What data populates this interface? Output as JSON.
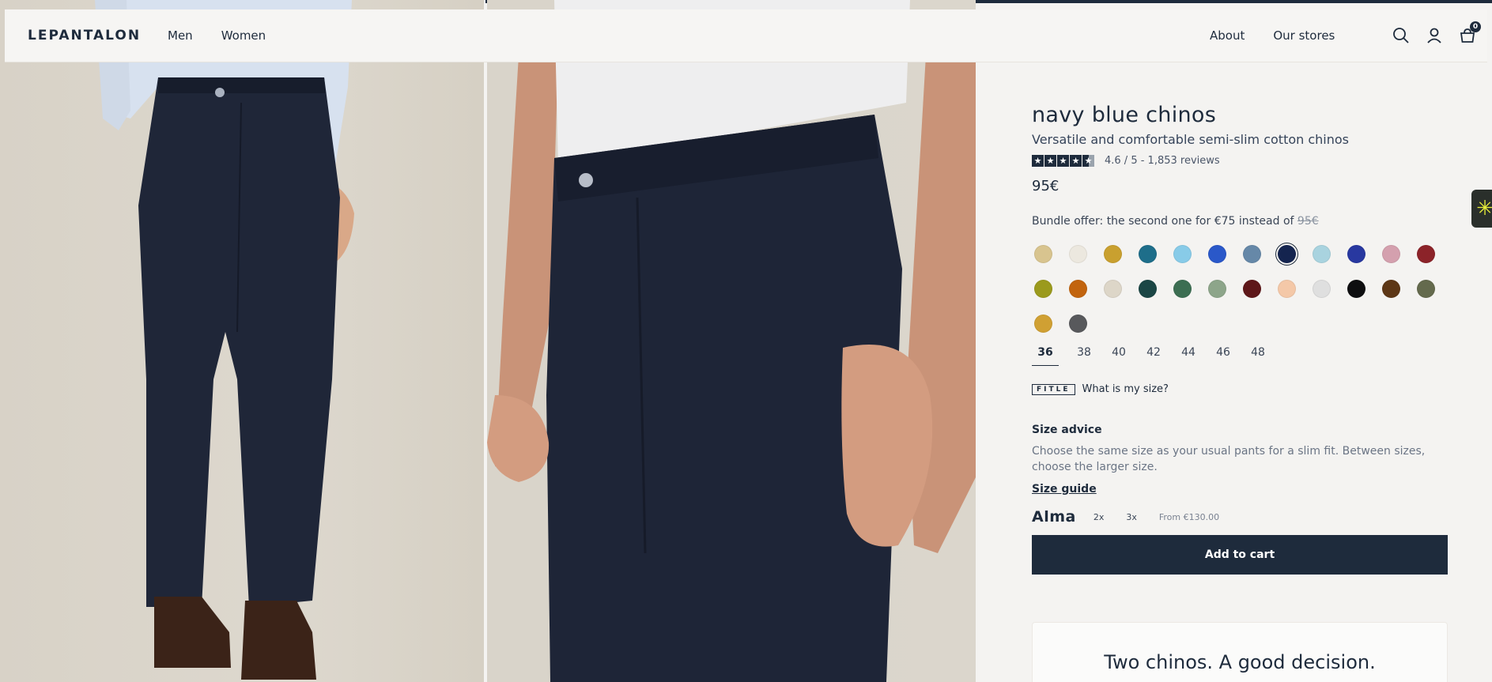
{
  "header": {
    "logo": "LEPANTALON",
    "nav_left": [
      "Men",
      "Women"
    ],
    "nav_right": [
      "About",
      "Our stores"
    ],
    "cart_count": "0"
  },
  "product": {
    "title": "navy blue chinos",
    "subtitle": "Versatile and comfortable semi-slim cotton chinos",
    "rating_text": "4.6 / 5 - 1,853 reviews",
    "rating_value": 4.6,
    "price": "95€",
    "bundle_text": "Bundle offer: the second one for €75 instead of",
    "bundle_old_price": "95€",
    "colors": [
      "#d8c48f",
      "#ece8df",
      "#c9a02f",
      "#1e6e8a",
      "#88cbe8",
      "#2a58c9",
      "#6688a8",
      "#14244f",
      "#a9d3df",
      "#2838a0",
      "#d4a0ae",
      "#8c2329",
      "#9b9a1d",
      "#c2640e",
      "#ddd6c8",
      "#1b4645",
      "#3c6e52",
      "#8da58a",
      "#5e1719",
      "#f4c8a8",
      "#dfdfdf",
      "#0e0e10",
      "#5d3716",
      "#646a4d",
      "#d0a033",
      "#58595c"
    ],
    "selected_color_index": 7,
    "sizes": [
      "36",
      "38",
      "40",
      "42",
      "44",
      "46",
      "48"
    ],
    "active_size": "36",
    "fitle_logo": "FITLE",
    "fitle_text": "What is my size?",
    "advice_title": "Size advice",
    "advice_text": "Choose the same size as your usual pants for a slim fit. Between sizes, choose the larger size.",
    "size_guide": "Size guide",
    "alma_logo": "Alma",
    "alma_options": [
      "2x",
      "3x"
    ],
    "alma_from": "From €130.00",
    "add_to_cart": "Add to cart"
  },
  "promo": {
    "title": "Two chinos. A good decision."
  },
  "colors": {
    "primary": "#1e2b3c",
    "background": "#f4f3f1",
    "widget_accent": "#e8ee3a"
  },
  "icons": [
    "search-icon",
    "user-icon",
    "cart-icon",
    "spark-icon"
  ]
}
